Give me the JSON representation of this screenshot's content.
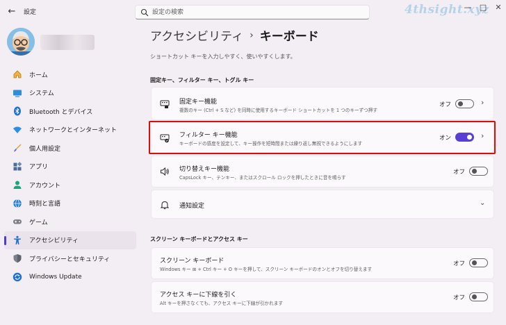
{
  "window": {
    "app_title": "設定",
    "back_icon": "back-arrow-icon",
    "watermark": "4thsight.xyz",
    "controls": {
      "minimize": "—",
      "maximize": "□",
      "close": "✕"
    }
  },
  "search": {
    "placeholder": "設定の検索"
  },
  "sidebar": {
    "items": [
      {
        "label": "ホーム",
        "icon": "home-icon"
      },
      {
        "label": "システム",
        "icon": "system-icon"
      },
      {
        "label": "Bluetooth とデバイス",
        "icon": "bluetooth-icon"
      },
      {
        "label": "ネットワークとインターネット",
        "icon": "network-icon"
      },
      {
        "label": "個人用設定",
        "icon": "personalization-icon"
      },
      {
        "label": "アプリ",
        "icon": "apps-icon"
      },
      {
        "label": "アカウント",
        "icon": "account-icon"
      },
      {
        "label": "時刻と言語",
        "icon": "time-language-icon"
      },
      {
        "label": "ゲーム",
        "icon": "gaming-icon"
      },
      {
        "label": "アクセシビリティ",
        "icon": "accessibility-icon",
        "active": true
      },
      {
        "label": "プライバシーとセキュリティ",
        "icon": "privacy-shield-icon"
      },
      {
        "label": "Windows Update",
        "icon": "windows-update-icon"
      }
    ]
  },
  "main": {
    "breadcrumb": {
      "parent": "アクセシビリティ",
      "separator": "›",
      "current": "キーボード"
    },
    "description": "ショートカット キーを入力しやすく、使いやすくします。",
    "section1": {
      "title": "固定キー、フィルター キー、トグル キー",
      "sticky": {
        "title": "固定キー機能",
        "subtitle": "複数のキー (Ctrl + S など) を同時に使用するキーボード ショートカットを 1 つのキーずつ押す",
        "state": "オフ",
        "on": false
      },
      "filter": {
        "title": "フィルター キー機能",
        "subtitle": "キーボードの感度を設定して、キー操作を短時間または繰り返し無視できるようにします",
        "state": "オン",
        "on": true
      },
      "toggle_keys": {
        "title": "切り替えキー機能",
        "subtitle": "CapsLock キー、テンキー、またはスクロール ロックを押したときに音を鳴らす",
        "state": "オフ",
        "on": false
      },
      "notifications": {
        "title": "通知設定"
      }
    },
    "section2": {
      "title": "スクリーン キーボードとアクセス キー",
      "onscreen": {
        "title": "スクリーン キーボード",
        "subtitle": "Windows キー ⊞ + Ctrl キー + O キーを押して、スクリーン キーボードのオンとオフを切り替えます",
        "state": "オフ",
        "on": false
      },
      "underline": {
        "title": "アクセス キーに下線を引く",
        "subtitle": "Alt キーを押さなくても、アクセス キーに下線が引かれます",
        "state": "オフ",
        "on": false
      }
    }
  },
  "colors": {
    "accent": "#5a3fd6",
    "highlight_box": "#d60e0e",
    "background": "#f3eef3"
  }
}
